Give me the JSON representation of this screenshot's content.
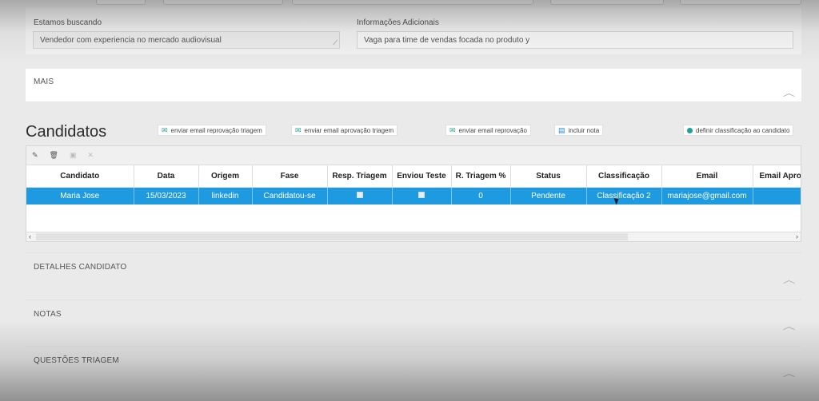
{
  "job_fields": {
    "seeking_label": "Estamos buscando",
    "seeking_value": "Vendedor com experiencia no mercado audiovisual",
    "additional_label": "Informações Adicionais",
    "additional_value": "Vaga para time de vendas focada no produto y"
  },
  "panels": {
    "more": "MAIS",
    "candidate_details": "DETALHES CANDIDATO",
    "notes": "NOTAS",
    "screening_questions": "QUESTÕES TRIAGEM"
  },
  "candidates": {
    "title": "Candidatos",
    "actions": {
      "reject_screening_email": "enviar email reprovação triagem",
      "approve_screening_email": "enviar email aprovação triagem",
      "reject_email": "enviar email reprovação",
      "add_note": "incluir nota",
      "set_classification": "definir classificação ao candidato"
    },
    "columns": [
      "Candidato",
      "Data",
      "Origem",
      "Fase",
      "Resp. Triagem",
      "Enviou Teste",
      "R. Triagem %",
      "Status",
      "Classificação",
      "Email",
      "Email Aprov"
    ],
    "rows": [
      {
        "candidate": "Maria Jose",
        "date": "15/03/2023",
        "origin": "linkedin",
        "phase": "Candidatou-se",
        "screening_answered": false,
        "test_sent": false,
        "screening_pct": "0",
        "status": "Pendente",
        "classification": "Classificação 2",
        "email": "mariajose@gmail.com",
        "email_approval": ""
      }
    ]
  },
  "icons": {
    "pin": "pin-icon",
    "delete": "trash-icon",
    "save": "save-icon",
    "close": "close-icon",
    "chevron": "chevron-up-icon"
  },
  "colors": {
    "selected_row": "#1e9ae0",
    "accent": "#1aa39a"
  }
}
